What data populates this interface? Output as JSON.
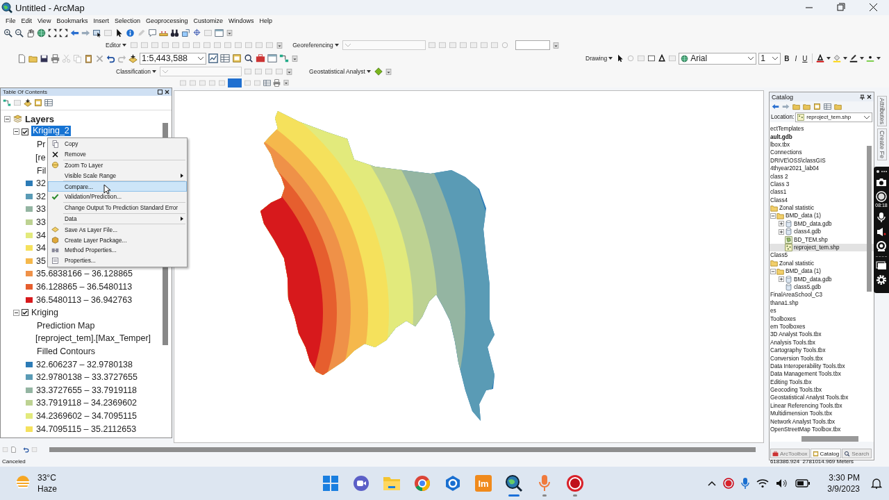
{
  "window": {
    "title": "Untitled - ArcMap"
  },
  "menu": [
    "File",
    "Edit",
    "View",
    "Bookmarks",
    "Insert",
    "Selection",
    "Geoprocessing",
    "Customize",
    "Windows",
    "Help"
  ],
  "toolbars": {
    "editor": "Editor",
    "georeferencing": "Georeferencing",
    "scale": "1:5,443,588",
    "classification": "Classification",
    "geostatistical": "Geostatistical Analyst",
    "drawing": "Drawing",
    "font": "Arial",
    "font_size": "1",
    "bold": "B",
    "italic": "I",
    "underline": "U"
  },
  "toc": {
    "title": "Table Of Contents",
    "root": "Layers",
    "root_expanded": true,
    "layers": [
      {
        "name": "Kriging_2",
        "checked": true,
        "selected": true,
        "expanded": true,
        "info": [
          "Pr",
          "[re",
          "Fil"
        ],
        "classes": [
          {
            "label": "32",
            "color": "#2c7bb6"
          },
          {
            "label": "32",
            "color": "#5a9bb5"
          },
          {
            "label": "33",
            "color": "#94b5a2"
          },
          {
            "label": "33",
            "color": "#bdd292"
          },
          {
            "label": "34",
            "color": "#e2ea7c"
          },
          {
            "label": "34",
            "color": "#f5e15c"
          },
          {
            "label": "35",
            "color": "#f5b84c"
          },
          {
            "label": "35.6838166 – 36.128865",
            "color": "#ef9148"
          },
          {
            "label": "36.128865 – 36.5480113",
            "color": "#e65e2e"
          },
          {
            "label": "36.5480113 – 36.942763",
            "color": "#d7191c"
          }
        ]
      },
      {
        "name": "Kriging",
        "checked": true,
        "selected": false,
        "expanded": true,
        "info": [
          "Prediction Map",
          "[reproject_tem].[Max_Temper]",
          "Filled Contours"
        ],
        "classes": [
          {
            "label": "32.606237 – 32.9780138",
            "color": "#2c7bb6"
          },
          {
            "label": "32.9780138 – 33.3727655",
            "color": "#5a9bb5"
          },
          {
            "label": "33.3727655 – 33.7919118",
            "color": "#94b5a2"
          },
          {
            "label": "33.7919118 – 34.2369602",
            "color": "#bdd292"
          },
          {
            "label": "34.2369602 – 34.7095115",
            "color": "#e2ea7c"
          },
          {
            "label": "34.7095115 – 35.2112653",
            "color": "#f5e15c"
          }
        ]
      }
    ]
  },
  "context_menu": {
    "items": [
      {
        "label": "Copy",
        "submenu": false,
        "selected": false,
        "separator_before": false
      },
      {
        "label": "Remove",
        "submenu": false,
        "selected": false,
        "separator_before": false
      },
      {
        "label": "Zoom To Layer",
        "submenu": false,
        "selected": false,
        "separator_before": true
      },
      {
        "label": "Visible Scale Range",
        "submenu": true,
        "selected": false,
        "separator_before": false
      },
      {
        "label": "Compare...",
        "submenu": false,
        "selected": true,
        "separator_before": true
      },
      {
        "label": "Validation/Prediction...",
        "submenu": false,
        "selected": false,
        "separator_before": false
      },
      {
        "label": "Change Output To Prediction Standard Error",
        "submenu": false,
        "selected": false,
        "separator_before": true
      },
      {
        "label": "Data",
        "submenu": true,
        "selected": false,
        "separator_before": true
      },
      {
        "label": "Save As Layer File...",
        "submenu": false,
        "selected": false,
        "separator_before": true
      },
      {
        "label": "Create Layer Package...",
        "submenu": false,
        "selected": false,
        "separator_before": false
      },
      {
        "label": "Method Properties...",
        "submenu": false,
        "selected": false,
        "separator_before": false
      },
      {
        "label": "Properties...",
        "submenu": false,
        "selected": false,
        "separator_before": false
      }
    ]
  },
  "catalog": {
    "title": "Catalog",
    "location_label": "Location:",
    "location": "reproject_tem.shp",
    "items": [
      {
        "label": "ectTemplates",
        "kind": "plain",
        "selected": false,
        "bold": false
      },
      {
        "label": "ault.gdb",
        "kind": "plain",
        "selected": false,
        "bold": true
      },
      {
        "label": "lbox.tbx",
        "kind": "plain",
        "selected": false,
        "bold": false
      },
      {
        "label": "Connections",
        "kind": "plain",
        "selected": false,
        "bold": false
      },
      {
        "label": "DRIVE\\OSS\\classGIS",
        "kind": "plain",
        "selected": false,
        "bold": false
      },
      {
        "label": "4thyear2021_lab04",
        "kind": "plain",
        "selected": false,
        "bold": false
      },
      {
        "label": "class 2",
        "kind": "plain",
        "selected": false,
        "bold": false
      },
      {
        "label": "Class 3",
        "kind": "plain",
        "selected": false,
        "bold": false
      },
      {
        "label": "class1",
        "kind": "plain",
        "selected": false,
        "bold": false
      },
      {
        "label": "Class4",
        "kind": "plain",
        "selected": false,
        "bold": false
      },
      {
        "label": "Zonal statistic",
        "kind": "folder",
        "selected": false,
        "bold": false,
        "children": [
          {
            "label": "BMD_data (1)",
            "kind": "folder",
            "expanded": true,
            "selected": false,
            "bold": false,
            "children": [
              {
                "label": "BMD_data.gdb",
                "kind": "database",
                "expanded": false,
                "selected": false,
                "bold": false
              },
              {
                "label": "class4.gdb",
                "kind": "database",
                "expanded": false,
                "selected": false,
                "bold": false
              },
              {
                "label": "BD_TEM.shp",
                "kind": "polygon",
                "selected": false,
                "bold": false
              },
              {
                "label": "reproject_tem.shp",
                "kind": "points",
                "selected": true,
                "bold": false
              }
            ]
          }
        ]
      },
      {
        "label": "Class5",
        "kind": "plain",
        "selected": false,
        "bold": false
      },
      {
        "label": "Zonal statistic",
        "kind": "folder",
        "selected": false,
        "bold": false,
        "children": [
          {
            "label": "BMD_data (1)",
            "kind": "folder",
            "expanded": true,
            "selected": false,
            "bold": false,
            "children": [
              {
                "label": "BMD_data.gdb",
                "kind": "database",
                "expanded": false,
                "selected": false,
                "bold": false
              },
              {
                "label": "class5.gdb",
                "kind": "database",
                "selected": false,
                "bold": false
              }
            ]
          }
        ]
      },
      {
        "label": "FinalAreaSchool_C3",
        "kind": "plain",
        "selected": false,
        "bold": false
      },
      {
        "label": "thana1.shp",
        "kind": "plain",
        "selected": false,
        "bold": false
      },
      {
        "label": "es",
        "kind": "plain",
        "selected": false,
        "bold": false
      },
      {
        "label": "Toolboxes",
        "kind": "plain",
        "selected": false,
        "bold": false
      },
      {
        "label": "em Toolboxes",
        "kind": "plain",
        "selected": false,
        "bold": false
      },
      {
        "label": "3D Analyst Tools.tbx",
        "kind": "plain",
        "selected": false,
        "bold": false
      },
      {
        "label": "Analysis Tools.tbx",
        "kind": "plain",
        "selected": false,
        "bold": false
      },
      {
        "label": "Cartography Tools.tbx",
        "kind": "plain",
        "selected": false,
        "bold": false
      },
      {
        "label": "Conversion Tools.tbx",
        "kind": "plain",
        "selected": false,
        "bold": false
      },
      {
        "label": "Data Interoperability Tools.tbx",
        "kind": "plain",
        "selected": false,
        "bold": false
      },
      {
        "label": "Data Management Tools.tbx",
        "kind": "plain",
        "selected": false,
        "bold": false
      },
      {
        "label": "Editing Tools.tbx",
        "kind": "plain",
        "selected": false,
        "bold": false
      },
      {
        "label": "Geocoding Tools.tbx",
        "kind": "plain",
        "selected": false,
        "bold": false
      },
      {
        "label": "Geostatistical Analyst Tools.tbx",
        "kind": "plain",
        "selected": false,
        "bold": false
      },
      {
        "label": "Linear Referencing Tools.tbx",
        "kind": "plain",
        "selected": false,
        "bold": false
      },
      {
        "label": "Multidimension Tools.tbx",
        "kind": "plain",
        "selected": false,
        "bold": false
      },
      {
        "label": "Network Analyst Tools.tbx",
        "kind": "plain",
        "selected": false,
        "bold": false
      },
      {
        "label": "OpenStreetMap Toolbox.tbx",
        "kind": "plain",
        "selected": false,
        "bold": false
      }
    ],
    "tabs": [
      {
        "label": "ArcToolbox",
        "selected": false
      },
      {
        "label": "Catalog",
        "selected": true
      },
      {
        "label": "Search",
        "selected": false
      }
    ]
  },
  "side_tabs": [
    "Attributes",
    "Create Fe"
  ],
  "recorder": {
    "timer": "08:18"
  },
  "status_bar": {
    "message": "Canceled",
    "coordinates": "618386.924  2781014.969 Meters"
  },
  "taskbar": {
    "temperature": "33°C",
    "weather": "Haze",
    "app_letters": "lm",
    "apps": [
      {
        "selected": false,
        "running": false
      },
      {
        "selected": false,
        "running": false
      },
      {
        "selected": false,
        "running": false
      },
      {
        "selected": false,
        "running": false
      },
      {
        "selected": false,
        "running": false
      },
      {
        "selected": false,
        "running": false
      },
      {
        "selected": true,
        "running": true
      },
      {
        "selected": false,
        "running": true
      },
      {
        "selected": false,
        "running": true
      }
    ],
    "time": "3:30 PM",
    "date": "3/9/2023"
  }
}
